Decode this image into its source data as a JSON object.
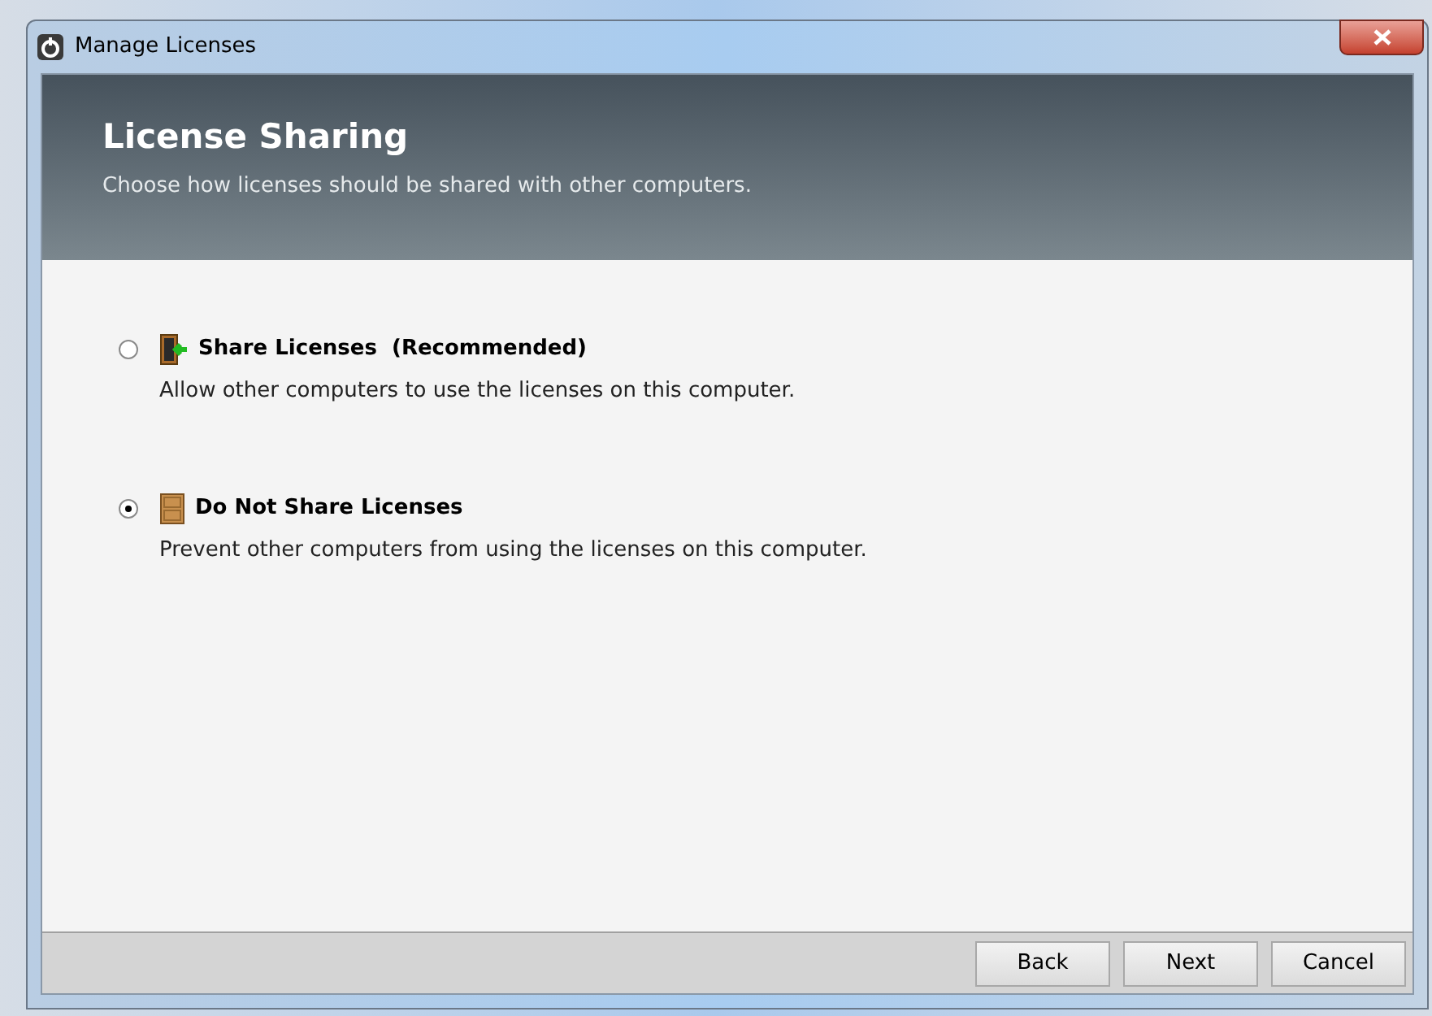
{
  "window": {
    "title": "Manage Licenses"
  },
  "header": {
    "title": "License Sharing",
    "subtitle": "Choose how licenses should be shared with other computers."
  },
  "options": [
    {
      "kind": "share",
      "label": "Share Licenses  (Recommended)",
      "description": "Allow other computers to use the licenses on this computer.",
      "selected": false
    },
    {
      "kind": "noshare",
      "label": "Do Not Share Licenses",
      "description": "Prevent other computers from using the licenses on this computer.",
      "selected": true
    }
  ],
  "buttons": [
    "Back",
    "Next",
    "Cancel"
  ]
}
